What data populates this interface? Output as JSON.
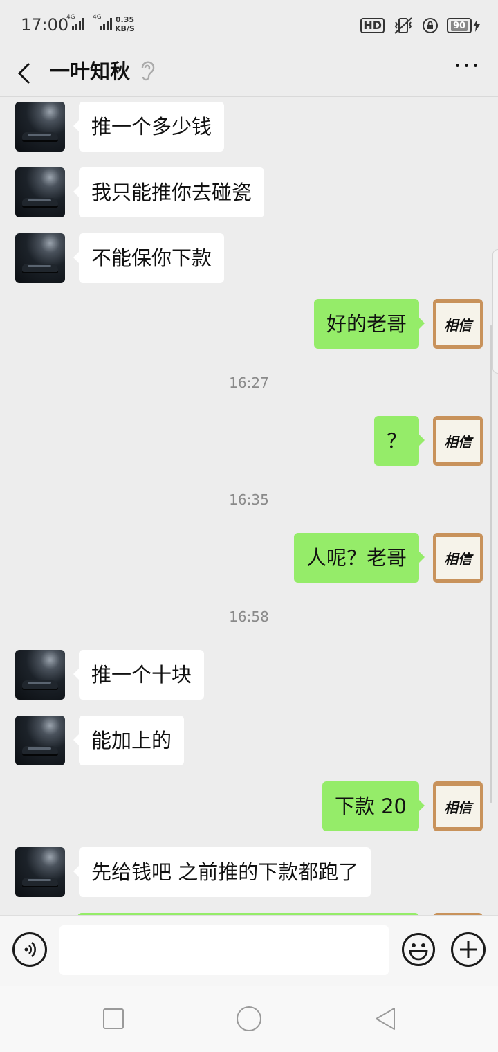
{
  "status_bar": {
    "time": "17:00",
    "network_speed_value": "0.35",
    "network_speed_unit": "KB/S",
    "signal_label_1": "4G",
    "signal_label_2": "4G",
    "hd_label": "HD",
    "battery": "90"
  },
  "header": {
    "title": "一叶知秋"
  },
  "contact_avatar_icon": "dark-sports-car-avatar",
  "self_avatar_icon": "calligraphy-avatar",
  "self_avatar_text": "相信",
  "messages": [
    {
      "side": "in",
      "text": "推一个多少钱"
    },
    {
      "side": "in",
      "text": "我只能推你去碰瓷"
    },
    {
      "side": "in",
      "text": "不能保你下款"
    },
    {
      "side": "out",
      "text": "好的老哥"
    },
    {
      "type": "time",
      "text": "16:27"
    },
    {
      "side": "out",
      "text": "？"
    },
    {
      "type": "time",
      "text": "16:35"
    },
    {
      "side": "out",
      "text": "人呢？老哥"
    },
    {
      "type": "time",
      "text": "16:58"
    },
    {
      "side": "in",
      "text": "推一个十块"
    },
    {
      "side": "in",
      "text": "能加上的"
    },
    {
      "side": "out",
      "text": "下款 20"
    },
    {
      "side": "in",
      "text": "先给钱吧 之前推的下款都跑了"
    }
  ],
  "input_bar": {
    "placeholder": "",
    "value": ""
  },
  "colors": {
    "outgoing_bubble": "#95ec69",
    "incoming_bubble": "#ffffff",
    "background": "#ededed"
  }
}
